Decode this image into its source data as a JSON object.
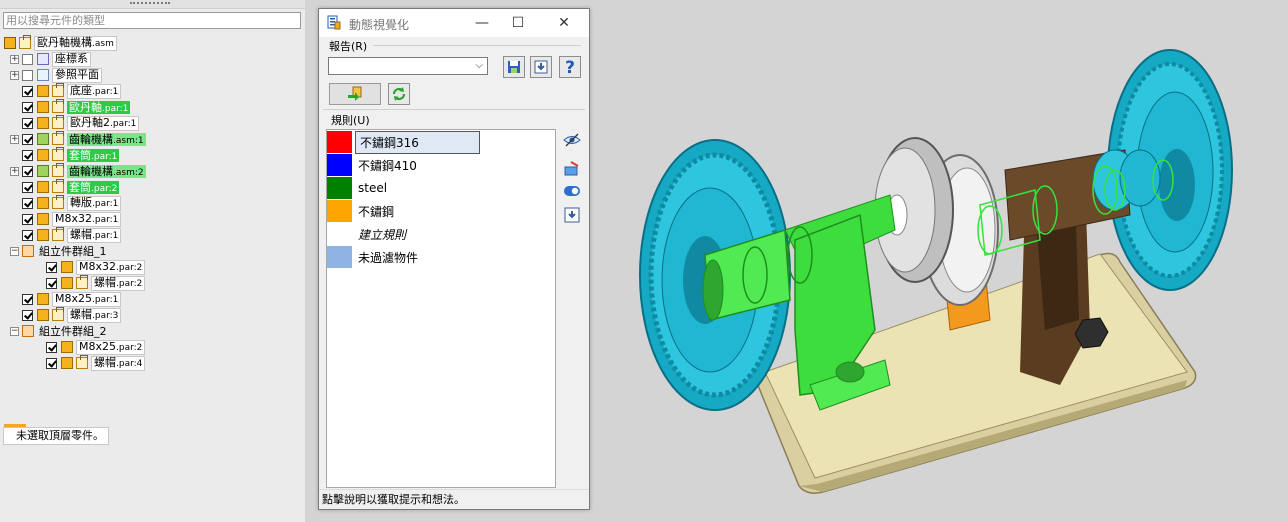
{
  "left_pane": {
    "search_placeholder": "用以搜尋元件的類型",
    "tree": [
      {
        "label": "歐丹軸機構",
        "ext": ".asm",
        "style": "box"
      },
      {
        "label": "座標系",
        "ext": "",
        "style": "box"
      },
      {
        "label": "參照平面",
        "ext": "",
        "style": "box"
      },
      {
        "label": "底座",
        "ext": ".par:1",
        "style": "box"
      },
      {
        "label": "歐丹軸",
        "ext": ".par:1",
        "style": "hl"
      },
      {
        "label": "歐丹軸2",
        "ext": ".par:1",
        "style": "box"
      },
      {
        "label": "齒輪機構",
        "ext": ".asm:1",
        "style": "hl2"
      },
      {
        "label": "套筒",
        "ext": ".par:1",
        "style": "hl"
      },
      {
        "label": "齒輪機構",
        "ext": ".asm:2",
        "style": "hl2"
      },
      {
        "label": "套筒",
        "ext": ".par:2",
        "style": "hl"
      },
      {
        "label": "轉版",
        "ext": ".par:1",
        "style": "box"
      },
      {
        "label": "M8x32",
        "ext": ".par:1",
        "style": "box"
      },
      {
        "label": "螺帽",
        "ext": ".par:1",
        "style": "box"
      },
      {
        "label": "組立件群組_1",
        "ext": "",
        "style": "plain"
      },
      {
        "label": "M8x32",
        "ext": ".par:2",
        "style": "box"
      },
      {
        "label": "螺帽",
        "ext": ".par:2",
        "style": "box"
      },
      {
        "label": "M8x25",
        "ext": ".par:1",
        "style": "box"
      },
      {
        "label": "螺帽",
        "ext": ".par:3",
        "style": "box"
      },
      {
        "label": "組立件群組_2",
        "ext": "",
        "style": "plain"
      },
      {
        "label": "M8x25",
        "ext": ".par:2",
        "style": "box"
      },
      {
        "label": "螺帽",
        "ext": ".par:4",
        "style": "box"
      }
    ],
    "bottom_button": "未選取頂層零件。"
  },
  "dialog": {
    "title": "動態視覺化",
    "report_label": "報告(R)",
    "report_value": "",
    "rules_label": "規則(U)",
    "rules": [
      {
        "name": "不鏽鋼316",
        "color": "#ff0000"
      },
      {
        "name": "不鏽鋼410",
        "color": "#0000ff"
      },
      {
        "name": "steel",
        "color": "#008000"
      },
      {
        "name": "不鏽鋼",
        "color": "#ffa500"
      },
      {
        "name": "建立規則",
        "color": ""
      },
      {
        "name": "未過濾物件",
        "color": "#8db4e2"
      }
    ],
    "status": "點擊說明以獲取提示和想法。",
    "min_glyph": "—",
    "max_glyph": "☐",
    "close_glyph": "✕"
  },
  "icons": {
    "title_app": "dynamic-visualization-icon",
    "save_report": "save-icon",
    "load_report": "download-icon",
    "help": "help-icon",
    "apply": "apply-rules-icon",
    "refresh": "refresh-icon"
  },
  "colors": {
    "highlight_green": "#2ccb46",
    "part_cyan": "#21b8d6",
    "part_green": "#3ddd3d",
    "part_brown": "#6b4a2a",
    "part_orange": "#f39a1e",
    "base_cream": "#ece3b5"
  }
}
